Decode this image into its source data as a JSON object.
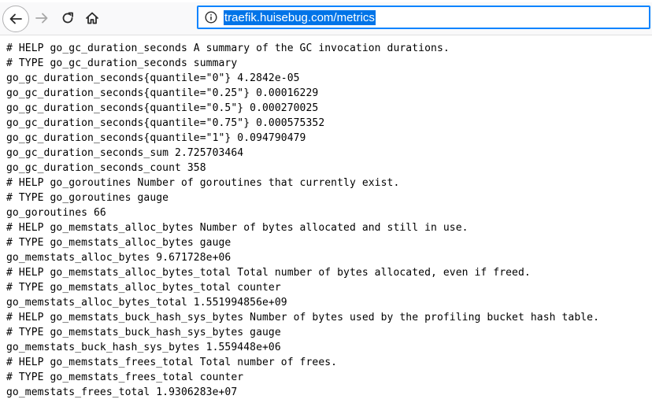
{
  "browser": {
    "url": "traefik.huisebug.com/metrics",
    "icons": {
      "back": "arrow-left-icon",
      "forward": "arrow-right-icon",
      "reload": "reload-icon",
      "home": "home-icon",
      "site_info": "info-circle-icon"
    },
    "accent": "#0a84ff",
    "selection_color": "#0074e8"
  },
  "metrics": {
    "lines": [
      "# HELP go_gc_duration_seconds A summary of the GC invocation durations.",
      "# TYPE go_gc_duration_seconds summary",
      "go_gc_duration_seconds{quantile=\"0\"} 4.2842e-05",
      "go_gc_duration_seconds{quantile=\"0.25\"} 0.00016229",
      "go_gc_duration_seconds{quantile=\"0.5\"} 0.000270025",
      "go_gc_duration_seconds{quantile=\"0.75\"} 0.000575352",
      "go_gc_duration_seconds{quantile=\"1\"} 0.094790479",
      "go_gc_duration_seconds_sum 2.725703464",
      "go_gc_duration_seconds_count 358",
      "# HELP go_goroutines Number of goroutines that currently exist.",
      "# TYPE go_goroutines gauge",
      "go_goroutines 66",
      "# HELP go_memstats_alloc_bytes Number of bytes allocated and still in use.",
      "# TYPE go_memstats_alloc_bytes gauge",
      "go_memstats_alloc_bytes 9.671728e+06",
      "# HELP go_memstats_alloc_bytes_total Total number of bytes allocated, even if freed.",
      "# TYPE go_memstats_alloc_bytes_total counter",
      "go_memstats_alloc_bytes_total 1.551994856e+09",
      "# HELP go_memstats_buck_hash_sys_bytes Number of bytes used by the profiling bucket hash table.",
      "# TYPE go_memstats_buck_hash_sys_bytes gauge",
      "go_memstats_buck_hash_sys_bytes 1.559448e+06",
      "# HELP go_memstats_frees_total Total number of frees.",
      "# TYPE go_memstats_frees_total counter",
      "go_memstats_frees_total 1.9306283e+07"
    ]
  }
}
